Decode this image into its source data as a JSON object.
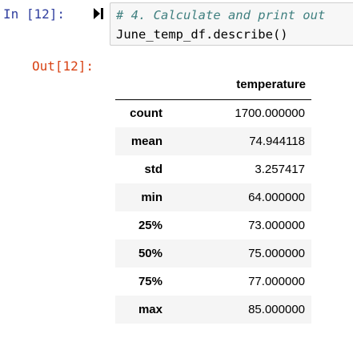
{
  "input_cell": {
    "prompt": "In [12]:",
    "code_comment": "# 4. Calculate and print out",
    "code_statement": "June_temp_df.describe()"
  },
  "output_cell": {
    "prompt": "Out[12]:",
    "table": {
      "column_header": "temperature",
      "rows": [
        {
          "label": "count",
          "value": "1700.000000"
        },
        {
          "label": "mean",
          "value": "74.944118"
        },
        {
          "label": "std",
          "value": "3.257417"
        },
        {
          "label": "min",
          "value": "64.000000"
        },
        {
          "label": "25%",
          "value": "73.000000"
        },
        {
          "label": "50%",
          "value": "75.000000"
        },
        {
          "label": "75%",
          "value": "77.000000"
        },
        {
          "label": "max",
          "value": "85.000000"
        }
      ]
    }
  },
  "colors": {
    "in_prompt": "#303f9f",
    "out_prompt": "#d84315",
    "comment": "#408080",
    "input_background": "#f7f7f7",
    "row_stripe": "#f5f5f5"
  },
  "icons": {
    "run_button": "run-cell-icon"
  }
}
